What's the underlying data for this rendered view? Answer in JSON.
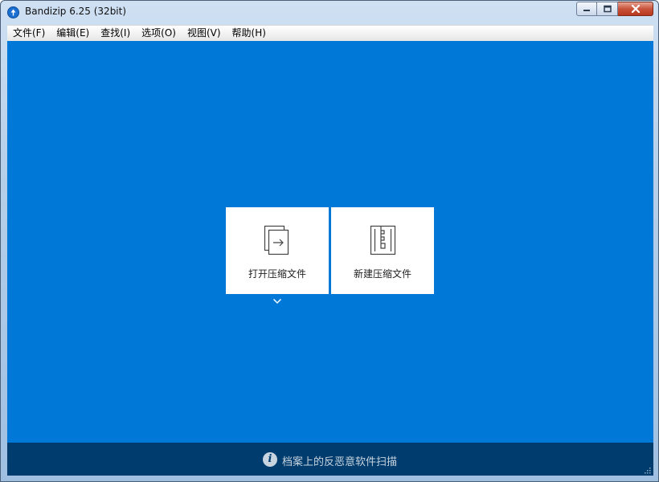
{
  "window": {
    "title": "Bandizip 6.25 (32bit)",
    "app_icon": "bandizip-icon",
    "buttons": [
      "minimize-icon",
      "maximize-icon",
      "close-icon"
    ]
  },
  "menu": [
    {
      "label": "文件(F)"
    },
    {
      "label": "编辑(E)"
    },
    {
      "label": "查找(I)"
    },
    {
      "label": "选项(O)"
    },
    {
      "label": "视图(V)"
    },
    {
      "label": "帮助(H)"
    }
  ],
  "tiles": [
    {
      "label": "打开压缩文件",
      "icon": "open-archive-icon"
    },
    {
      "label": "新建压缩文件",
      "icon": "new-archive-icon"
    }
  ],
  "expand_icon": "chevron-down-icon",
  "status": {
    "icon": "info-icon",
    "text": "档案上的反恶意软件扫描"
  },
  "colors": {
    "main_background": "#0078d7",
    "status_background": "#003c6e",
    "tile_background": "#ffffff",
    "status_text": "#c8d4df"
  }
}
